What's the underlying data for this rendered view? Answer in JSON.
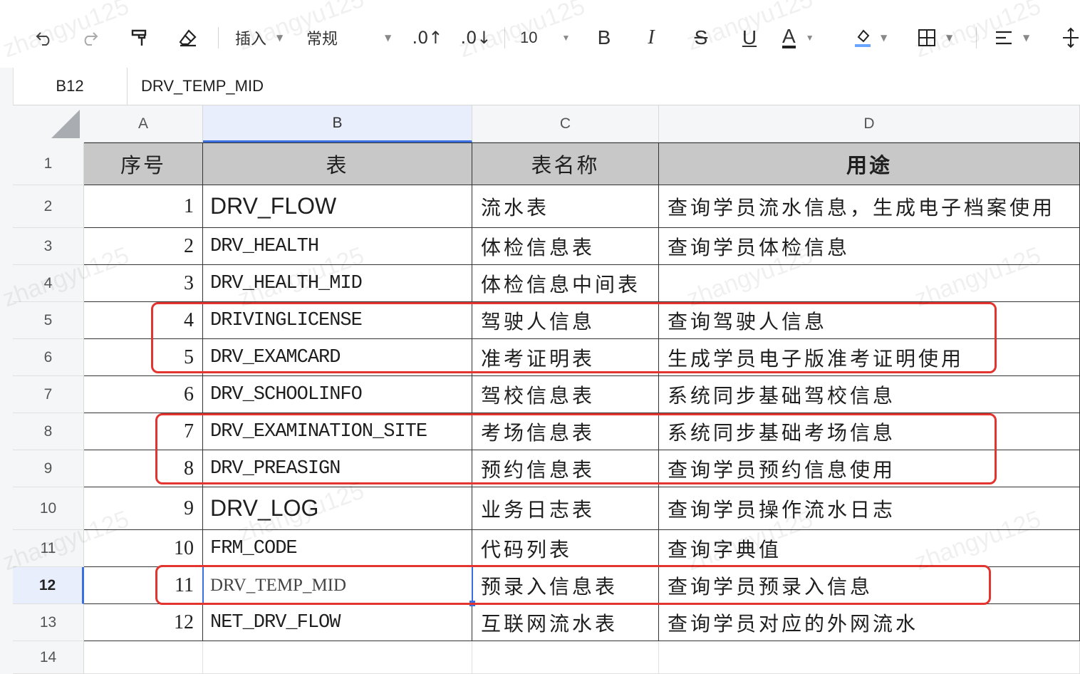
{
  "toolbar": {
    "insert_label": "插入",
    "format_label": "常规",
    "decimal_inc_label": ".0↑",
    "decimal_dec_label": ".0↓",
    "font_size": "10",
    "bold_label": "B",
    "italic_label": "I",
    "strike_label": "S",
    "underline_label": "U",
    "font_color_label": "A"
  },
  "formula_bar": {
    "cell_ref": "B12",
    "value": "DRV_TEMP_MID"
  },
  "columns": [
    "A",
    "B",
    "C",
    "D"
  ],
  "rows": [
    "1",
    "2",
    "3",
    "4",
    "5",
    "6",
    "7",
    "8",
    "9",
    "10",
    "11",
    "12",
    "13",
    "14"
  ],
  "header": {
    "seq": "序号",
    "table": "表",
    "table_name": "表名称",
    "usage": "用途"
  },
  "data": [
    {
      "seq": "1",
      "table": "DRV_FLOW",
      "name": "流水表",
      "usage": "查询学员流水信息，生成电子档案使用"
    },
    {
      "seq": "2",
      "table": "DRV_HEALTH",
      "name": "体检信息表",
      "usage": "查询学员体检信息"
    },
    {
      "seq": "3",
      "table": "DRV_HEALTH_MID",
      "name": "体检信息中间表",
      "usage": ""
    },
    {
      "seq": "4",
      "table": "DRIVINGLICENSE",
      "name": "驾驶人信息",
      "usage": "查询驾驶人信息"
    },
    {
      "seq": "5",
      "table": "DRV_EXAMCARD",
      "name": "准考证明表",
      "usage": "生成学员电子版准考证明使用"
    },
    {
      "seq": "6",
      "table": "DRV_SCHOOLINFO",
      "name": "驾校信息表",
      "usage": "系统同步基础驾校信息"
    },
    {
      "seq": "7",
      "table": "DRV_EXAMINATION_SITE",
      "name": "考场信息表",
      "usage": "系统同步基础考场信息"
    },
    {
      "seq": "8",
      "table": "DRV_PREASIGN",
      "name": "预约信息表",
      "usage": "查询学员预约信息使用"
    },
    {
      "seq": "9",
      "table": "DRV_LOG",
      "name": "业务日志表",
      "usage": "查询学员操作流水日志"
    },
    {
      "seq": "10",
      "table": "FRM_CODE",
      "name": "代码列表",
      "usage": "查询字典值"
    },
    {
      "seq": "11",
      "table": "DRV_TEMP_MID",
      "name": "预录入信息表",
      "usage": "查询学员预录入信息"
    },
    {
      "seq": "12",
      "table": "NET_DRV_FLOW",
      "name": "互联网流水表",
      "usage": "查询学员对应的外网流水"
    }
  ],
  "watermark": "zhangyu125",
  "colors": {
    "header_fill": "#c8c8c8",
    "highlight": "#e3342f",
    "selection": "#3b6fe0"
  }
}
